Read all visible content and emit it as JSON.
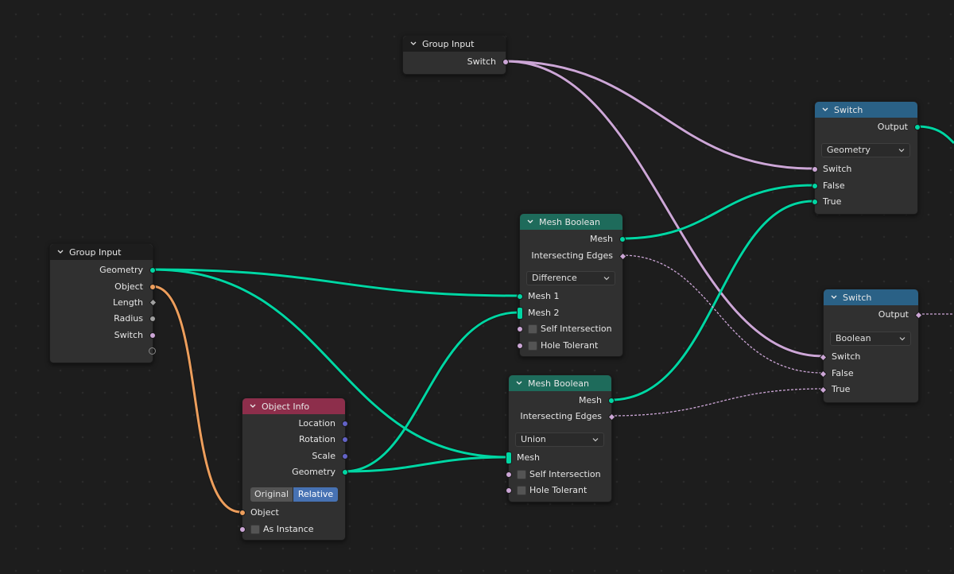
{
  "nodes": {
    "group_input_top": {
      "title": "Group Input",
      "outputs": [
        "Switch"
      ]
    },
    "group_input_left": {
      "title": "Group Input",
      "outputs": [
        "Geometry",
        "Object",
        "Length",
        "Radius",
        "Switch"
      ]
    },
    "object_info": {
      "title": "Object Info",
      "outputs": [
        "Location",
        "Rotation",
        "Scale",
        "Geometry"
      ],
      "mode_options": [
        "Original",
        "Relative"
      ],
      "mode_selected": "Relative",
      "inputs": [
        "Object",
        "As Instance"
      ]
    },
    "mesh_boolean_1": {
      "title": "Mesh Boolean",
      "outputs": [
        "Mesh",
        "Intersecting Edges"
      ],
      "operation": "Difference",
      "inputs": [
        "Mesh 1",
        "Mesh 2",
        "Self Intersection",
        "Hole Tolerant"
      ]
    },
    "mesh_boolean_2": {
      "title": "Mesh Boolean",
      "outputs": [
        "Mesh",
        "Intersecting Edges"
      ],
      "operation": "Union",
      "inputs": [
        "Mesh",
        "Self Intersection",
        "Hole Tolerant"
      ]
    },
    "switch_top": {
      "title": "Switch",
      "outputs": [
        "Output"
      ],
      "type": "Geometry",
      "inputs": [
        "Switch",
        "False",
        "True"
      ]
    },
    "switch_bottom": {
      "title": "Switch",
      "outputs": [
        "Output"
      ],
      "type": "Boolean",
      "inputs": [
        "Switch",
        "False",
        "True"
      ]
    }
  },
  "colors": {
    "geometry": "#00d6a3",
    "object": "#ed9e5c",
    "boolean": "#cca6d6",
    "float": "#a1a1a1",
    "vector": "#6363c7"
  }
}
